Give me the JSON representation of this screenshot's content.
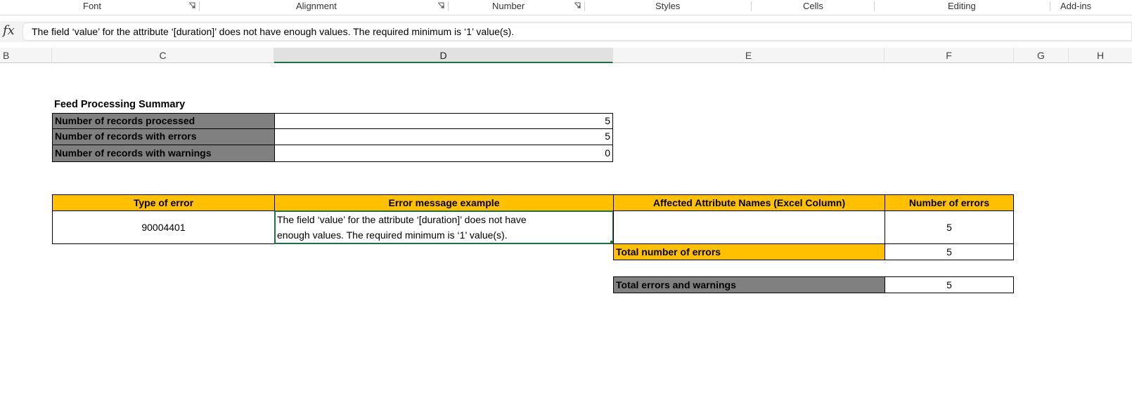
{
  "ribbon": {
    "groups": [
      "Font",
      "Alignment",
      "Number",
      "Styles",
      "Cells",
      "Editing",
      "Add-ins"
    ]
  },
  "formula_bar": {
    "fx_label": "fx",
    "content": "The field ‘value’  for the attribute ‘[duration]’  does not have enough values. The required minimum is ‘1’  value(s)."
  },
  "columns": [
    "B",
    "C",
    "D",
    "E",
    "F",
    "G",
    "H"
  ],
  "selected_column": "D",
  "summary": {
    "title": "Feed Processing Summary",
    "rows": [
      {
        "label": "Number of records processed",
        "value": "5"
      },
      {
        "label": "Number of records with errors",
        "value": "5"
      },
      {
        "label": "Number of records with warnings",
        "value": "0"
      }
    ]
  },
  "errors_table": {
    "headers": [
      "Type of error",
      "Error message example",
      "Affected Attribute Names (Excel Column)",
      "Number of errors"
    ],
    "row": {
      "type": "90004401",
      "message_line1": "The field ‘value’  for the attribute ‘[duration]’  does not have",
      "message_line2": "enough values. The required minimum is ‘1’  value(s).",
      "attributes": "",
      "count": "5"
    },
    "total_errors_label": "Total number of errors",
    "total_errors_value": "5",
    "total_all_label": "Total errors and warnings",
    "total_all_value": "5"
  },
  "colors": {
    "header_gold": "#ffc000",
    "label_gray": "#808080",
    "selection_green": "#1e7145"
  }
}
